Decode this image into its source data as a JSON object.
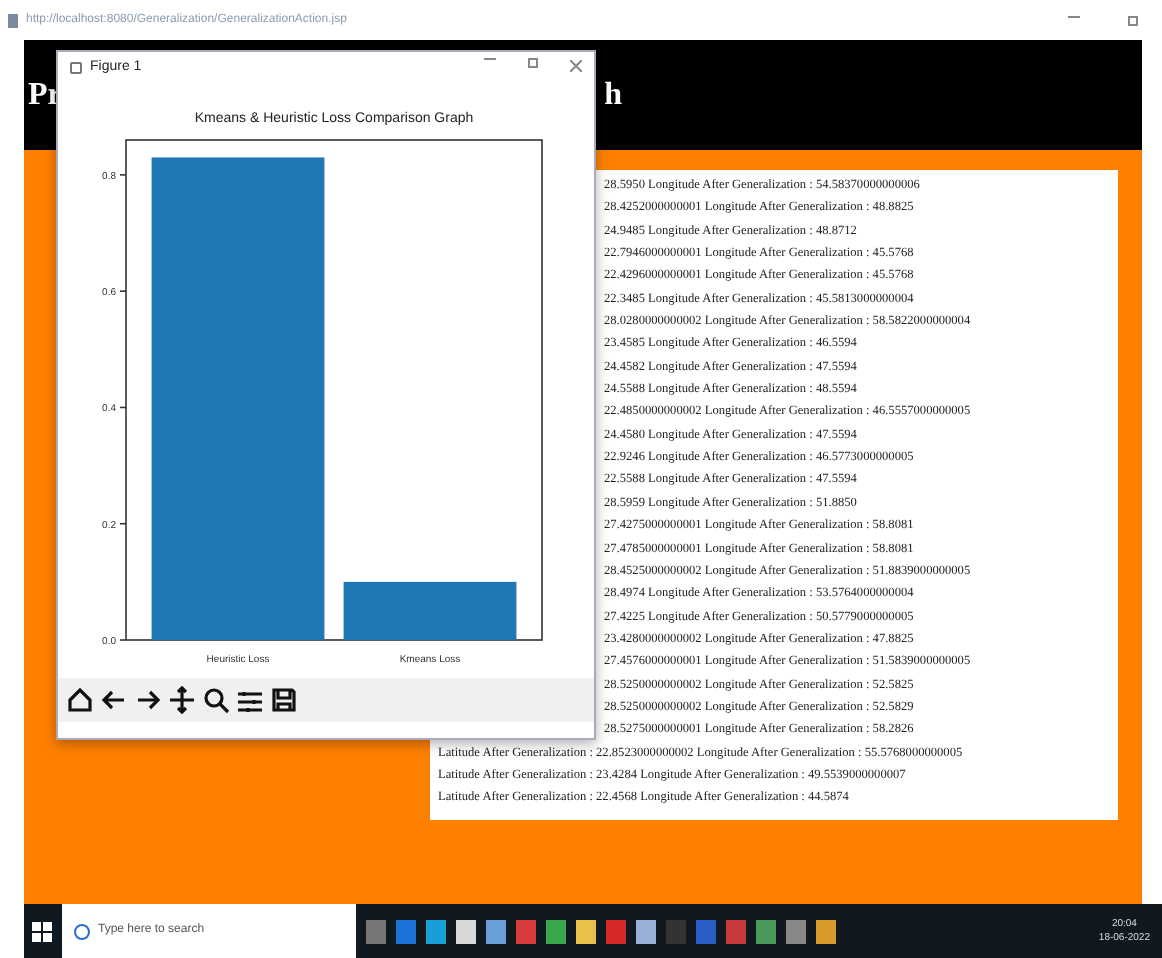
{
  "browser": {
    "title": "http://localhost:8080/Generalization/GeneralizationAction.jsp"
  },
  "header": {
    "left_text": "Pr",
    "right_text": "h"
  },
  "results": [
    {
      "kind": "partial",
      "text": "28.5950 Longitude After Generalization : 54.58370000000006"
    },
    {
      "kind": "partial",
      "text": "28.4252000000001 Longitude After Generalization : 48.8825"
    },
    {
      "kind": "partial",
      "text": "24.9485 Longitude After Generalization : 48.8712"
    },
    {
      "kind": "partial",
      "text": "22.7946000000001 Longitude After Generalization : 45.5768"
    },
    {
      "kind": "partial",
      "text": "22.4296000000001 Longitude After Generalization : 45.5768"
    },
    {
      "kind": "partial",
      "text": "22.3485 Longitude After Generalization : 45.5813000000004"
    },
    {
      "kind": "partial",
      "text": "28.0280000000002 Longitude After Generalization : 58.5822000000004"
    },
    {
      "kind": "partial",
      "text": "23.4585 Longitude After Generalization : 46.5594"
    },
    {
      "kind": "partial",
      "text": "24.4582 Longitude After Generalization : 47.5594"
    },
    {
      "kind": "partial",
      "text": "24.5588 Longitude After Generalization : 48.5594"
    },
    {
      "kind": "partial",
      "text": "22.4850000000002 Longitude After Generalization : 46.5557000000005"
    },
    {
      "kind": "partial",
      "text": "24.4580 Longitude After Generalization : 47.5594"
    },
    {
      "kind": "partial",
      "text": "22.9246 Longitude After Generalization : 46.5773000000005"
    },
    {
      "kind": "partial",
      "text": "22.5588 Longitude After Generalization : 47.5594"
    },
    {
      "kind": "partial",
      "text": "28.5959 Longitude After Generalization : 51.8850"
    },
    {
      "kind": "partial",
      "text": "27.4275000000001 Longitude After Generalization : 58.8081"
    },
    {
      "kind": "partial",
      "text": "27.4785000000001 Longitude After Generalization : 58.8081"
    },
    {
      "kind": "partial",
      "text": "28.4525000000002 Longitude After Generalization : 51.8839000000005"
    },
    {
      "kind": "partial",
      "text": "28.4974 Longitude After Generalization : 53.5764000000004"
    },
    {
      "kind": "partial",
      "text": "27.4225 Longitude After Generalization : 50.5779000000005"
    },
    {
      "kind": "partial",
      "text": "23.4280000000002 Longitude After Generalization : 47.8825"
    },
    {
      "kind": "partial",
      "text": "27.4576000000001 Longitude After Generalization : 51.5839000000005"
    },
    {
      "kind": "partial",
      "text": "28.5250000000002 Longitude After Generalization : 52.5825"
    },
    {
      "kind": "partial",
      "text": "28.5250000000002 Longitude After Generalization : 52.5829"
    },
    {
      "kind": "partial",
      "text": "28.5275000000001 Longitude After Generalization : 58.2826"
    },
    {
      "kind": "full",
      "text": "Latitude After Generalization : 22.8523000000002 Longitude After Generalization : 55.5768000000005"
    },
    {
      "kind": "full",
      "text": "Latitude After Generalization : 23.4284 Longitude After Generalization : 49.5539000000007"
    },
    {
      "kind": "full",
      "text": "Latitude After Generalization : 22.4568 Longitude After Generalization : 44.5874"
    }
  ],
  "figure_window": {
    "title": "Figure 1",
    "chart_data": {
      "type": "bar",
      "title": "Kmeans & Heuristic Loss Comparison Graph",
      "categories": [
        "Heuristic Loss",
        "Kmeans Loss"
      ],
      "values": [
        0.83,
        0.1
      ],
      "ylim": [
        0,
        0.86
      ],
      "yticks": [
        {
          "value": 0,
          "label": "0.0"
        },
        {
          "value": 0.2,
          "label": "0.2"
        },
        {
          "value": 0.4,
          "label": "0.4"
        },
        {
          "value": 0.6,
          "label": "0.6"
        },
        {
          "value": 0.8,
          "label": "0.8"
        }
      ]
    }
  },
  "taskbar": {
    "search_placeholder": "Type here to search",
    "time": "20:04",
    "date": "18-06-2022"
  }
}
